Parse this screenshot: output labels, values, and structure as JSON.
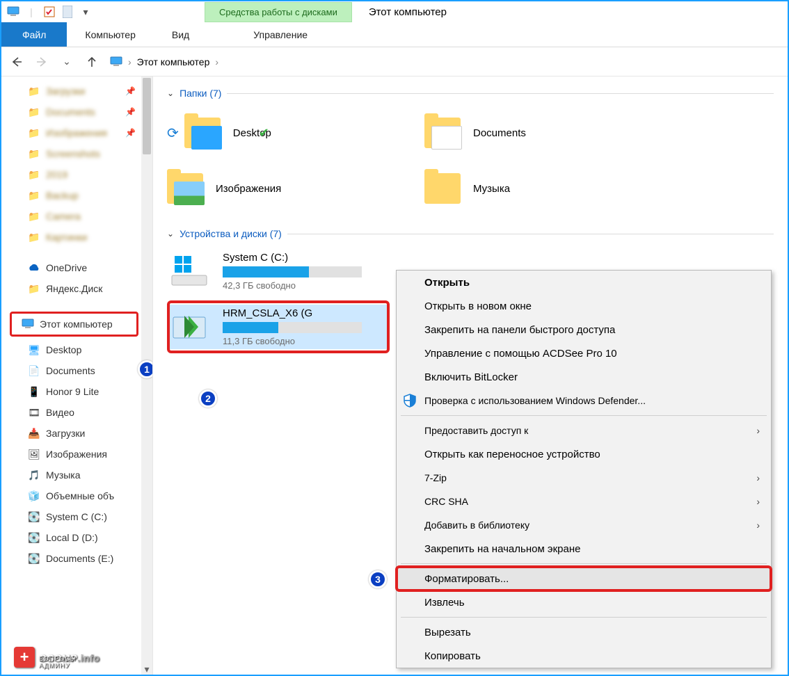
{
  "titlebar": {
    "drive_tools_label": "Средства работы с дисками",
    "title": "Этот компьютер"
  },
  "ribbon": {
    "file": "Файл",
    "computer": "Компьютер",
    "view": "Вид",
    "manage": "Управление"
  },
  "breadcrumb": {
    "root": "Этот компьютер"
  },
  "sidebar": {
    "blurred": [
      {
        "label": "Загрузки",
        "pin": true
      },
      {
        "label": "Documents",
        "pin": true
      },
      {
        "label": "Изображения",
        "pin": true
      },
      {
        "label": "Screenshots",
        "pin": false
      },
      {
        "label": "2019",
        "pin": false
      },
      {
        "label": "Backup",
        "pin": false
      },
      {
        "label": "Camera",
        "pin": false
      },
      {
        "label": "Картинки",
        "pin": false
      }
    ],
    "onedrive": "OneDrive",
    "yadisk": "Яндекс.Диск",
    "thispc": "Этот компьютер",
    "items": [
      {
        "label": "Desktop"
      },
      {
        "label": "Documents"
      },
      {
        "label": "Honor 9 Lite"
      },
      {
        "label": "Видео"
      },
      {
        "label": "Загрузки"
      },
      {
        "label": "Изображения"
      },
      {
        "label": "Музыка"
      },
      {
        "label": "Объемные объ"
      },
      {
        "label": "System C (C:)"
      },
      {
        "label": "Local D (D:)"
      },
      {
        "label": "Documents (E:)"
      }
    ]
  },
  "groups": {
    "folders_label": "Папки (7)",
    "drives_label": "Устройства и диски (7)"
  },
  "folders": [
    {
      "name": "Desktop",
      "check": true
    },
    {
      "name": "Documents"
    },
    {
      "name": "Изображения"
    },
    {
      "name": "Музыка"
    }
  ],
  "drives": [
    {
      "name": "System C (C:)",
      "free": "42,3 ГБ свободно",
      "fill_pct": 62
    },
    {
      "name": "HRM_CSLA_X6 (G",
      "free": "11,3 ГБ свободно",
      "fill_pct": 40
    }
  ],
  "ctx": {
    "open": "Открыть",
    "open_new": "Открыть в новом окне",
    "pin_quick": "Закрепить на панели быстрого доступа",
    "acdsee": "Управление с помощью ACDSee Pro 10",
    "bitlocker": "Включить BitLocker",
    "defender": "Проверка с использованием Windows Defender...",
    "share": "Предоставить доступ к",
    "portable": "Открыть как переносное устройство",
    "sevenzip": "7-Zip",
    "crcsha": "CRC SHA",
    "add_lib": "Добавить в библиотеку",
    "pin_start": "Закрепить на начальном экране",
    "format": "Форматировать...",
    "eject": "Извлечь",
    "cut": "Вырезать",
    "copy": "Копировать"
  },
  "badges": {
    "one": "1",
    "two": "2",
    "three": "3"
  },
  "watermark": {
    "brand": "OCOMP",
    "suffix": ".info",
    "sub": "ВОПРОСЫ АДМИНУ"
  }
}
